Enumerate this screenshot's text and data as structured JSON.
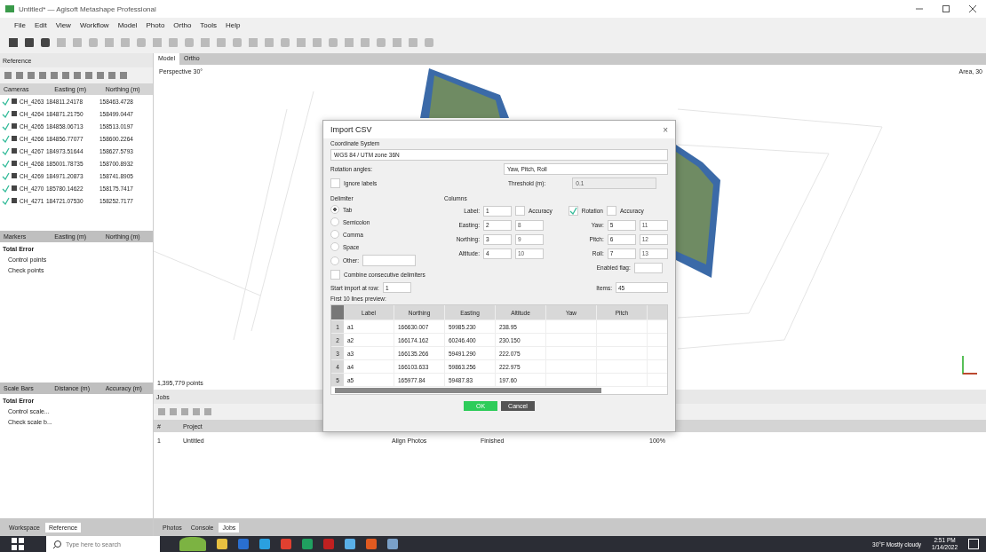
{
  "window": {
    "title": "Untitled* — Agisoft Metashape Professional"
  },
  "menu": [
    "File",
    "Edit",
    "View",
    "Workflow",
    "Model",
    "Photo",
    "Ortho",
    "Tools",
    "Help"
  ],
  "reference": {
    "title": "Reference",
    "camera_columns": [
      "Cameras",
      "Easting (m)",
      "Northing (m)"
    ],
    "cameras": [
      {
        "label": "CH_4263",
        "easting": "184811.24178",
        "northing": "158463.4728",
        "checked": true
      },
      {
        "label": "CH_4264",
        "easting": "184871.21750",
        "northing": "158499.0447",
        "checked": true
      },
      {
        "label": "CH_4265",
        "easting": "184858.06713",
        "northing": "158513.0197",
        "checked": true
      },
      {
        "label": "CH_4266",
        "easting": "184856.77077",
        "northing": "158600.2264",
        "checked": true
      },
      {
        "label": "CH_4267",
        "easting": "184973.51644",
        "northing": "158627.5793",
        "checked": true
      },
      {
        "label": "CH_4268",
        "easting": "185001.78735",
        "northing": "158700.8932",
        "checked": true
      },
      {
        "label": "CH_4269",
        "easting": "184971.20873",
        "northing": "158741.8905",
        "checked": true
      },
      {
        "label": "CH_4270",
        "easting": "185780.14622",
        "northing": "158175.7417",
        "checked": true
      },
      {
        "label": "CH_4271",
        "easting": "184721.07530",
        "northing": "158252.7177",
        "checked": true
      }
    ],
    "marker_columns": [
      "Markers",
      "Easting (m)",
      "Northing (m)"
    ],
    "marker_rows": [
      "Total Error",
      "Control points",
      "Check points"
    ],
    "scalebar_columns": [
      "Scale Bars",
      "Distance (m)",
      "Accuracy (m)"
    ],
    "scalebar_rows": [
      "Total Error",
      "Control scale...",
      "Check scale b..."
    ],
    "tabs": [
      {
        "label": "Workspace",
        "selected": false
      },
      {
        "label": "Reference",
        "selected": true
      }
    ]
  },
  "view": {
    "tabs": [
      {
        "label": "Model",
        "selected": true
      },
      {
        "label": "Ortho",
        "selected": false
      }
    ],
    "perspective": "Perspective 30°",
    "corner": "Area, 30",
    "points": "1,395,779 points"
  },
  "jobs": {
    "title": "Jobs",
    "columns": [
      "#",
      "Project"
    ],
    "rows": [
      {
        "number": "1",
        "project": "Untitled",
        "task": "Align Photos",
        "status": "Finished",
        "progress": "100%"
      }
    ],
    "tabs": [
      {
        "label": "Photos",
        "selected": false
      },
      {
        "label": "Console",
        "selected": false
      },
      {
        "label": "Jobs",
        "selected": true
      }
    ]
  },
  "dialog": {
    "title": "Import CSV",
    "close": "×",
    "coordinate_label": "Coordinate System",
    "coordinate_value": "WGS 84 / UTM zone 36N",
    "rotation_label": "Rotation angles:",
    "rotation_value": "Yaw, Pitch, Roll",
    "ignore_labels": {
      "label": "Ignore labels",
      "checked": false
    },
    "threshold_label": "Threshold (m):",
    "threshold_value": "0.1",
    "delimiter_title": "Delimiter",
    "delimiters": [
      {
        "label": "Tab",
        "selected": true
      },
      {
        "label": "Semicolon",
        "selected": false
      },
      {
        "label": "Comma",
        "selected": false
      },
      {
        "label": "Space",
        "selected": false
      },
      {
        "label": "Other:",
        "selected": false
      }
    ],
    "combine": {
      "label": "Combine consecutive delimiters",
      "checked": false
    },
    "columns_title": "Columns",
    "label_field": {
      "label": "Label:",
      "value": "1"
    },
    "accuracy_left": {
      "label": "Accuracy",
      "checked": false
    },
    "rotation": {
      "label": "Rotation",
      "checked": true
    },
    "accuracy_right": {
      "label": "Accuracy",
      "checked": false
    },
    "left_fields": [
      {
        "label": "Easting:",
        "value": "2",
        "extra": "8"
      },
      {
        "label": "Northing:",
        "value": "3",
        "extra": "9"
      },
      {
        "label": "Altitude:",
        "value": "4",
        "extra": "10"
      }
    ],
    "right_fields": [
      {
        "label": "Yaw:",
        "value": "5",
        "extra": "11"
      },
      {
        "label": "Pitch:",
        "value": "6",
        "extra": "12"
      },
      {
        "label": "Roll:",
        "value": "7",
        "extra": "13"
      }
    ],
    "enabled_flag": {
      "label": "Enabled flag:"
    },
    "start_label": "Start import at row:",
    "start_value": "1",
    "items_label": "Items:",
    "items_value": "45",
    "preview_label": "First 10 lines preview:",
    "preview_columns": [
      "Label",
      "Northing",
      "Easting",
      "Altitude",
      "Yaw",
      "Pitch"
    ],
    "preview_rows": [
      {
        "n": "1",
        "cells": [
          "a1",
          "166630.007",
          "59985.230",
          "238.95"
        ]
      },
      {
        "n": "2",
        "cells": [
          "a2",
          "166174.162",
          "60246.400",
          "230.150"
        ]
      },
      {
        "n": "3",
        "cells": [
          "a3",
          "166135.266",
          "59491.290",
          "222.075"
        ]
      },
      {
        "n": "4",
        "cells": [
          "a4",
          "166103.633",
          "59863.256",
          "222.975"
        ]
      },
      {
        "n": "5",
        "cells": [
          "a5",
          "165977.84",
          "59487.83",
          "197.60"
        ]
      }
    ],
    "ok": "OK",
    "cancel": "Cancel"
  },
  "taskbar": {
    "search_placeholder": "Type here to search",
    "weather": "30°F  Mostly cloudy",
    "time": "2:51 PM",
    "date": "1/14/2022"
  }
}
